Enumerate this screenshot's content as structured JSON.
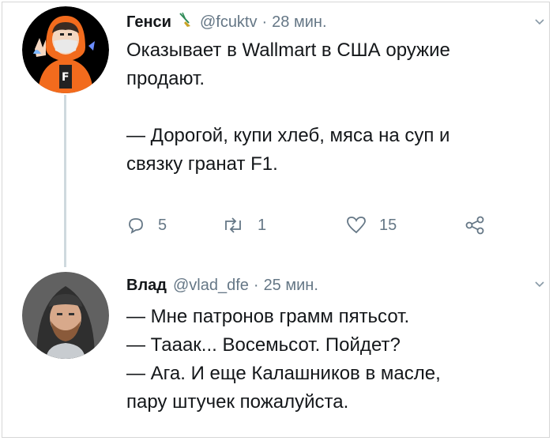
{
  "tweets": [
    {
      "name": "Генси",
      "badge_icon": "hacker-broom-emoji",
      "handle": "@fcuktv",
      "separator": "·",
      "time": "28 мин.",
      "lines": [
        "Оказывает в Wallmart в США оружие",
        "продают.",
        "",
        "— Дорогой, купи хлеб, мяса на суп и",
        "связку гранат F1."
      ],
      "actions": {
        "reply_count": "5",
        "retweet_count": "1",
        "like_count": "15"
      },
      "colors": {
        "avatar_bg": "#000000",
        "hoodie": "#f26b1d"
      }
    },
    {
      "name": "Влад",
      "handle": "@vlad_dfe",
      "separator": "·",
      "time": "25 мин.",
      "lines": [
        "— Мне патронов грамм пятьсот.",
        "— Тааак... Восемьсот. Пойдет?",
        "— Ага. И еще Калашников в масле,",
        "пару штучек пожалуйста."
      ],
      "colors": {
        "avatar_bg": "#5a5a5a"
      }
    }
  ],
  "icons": {
    "reply": "speech-bubble-icon",
    "retweet": "retweet-arrows-icon",
    "like": "heart-outline-icon",
    "share": "share-nodes-icon",
    "menu": "chevron-down-icon"
  },
  "theme": {
    "text": "#14171a",
    "muted": "#657786",
    "thread_line": "#cfd9de"
  }
}
